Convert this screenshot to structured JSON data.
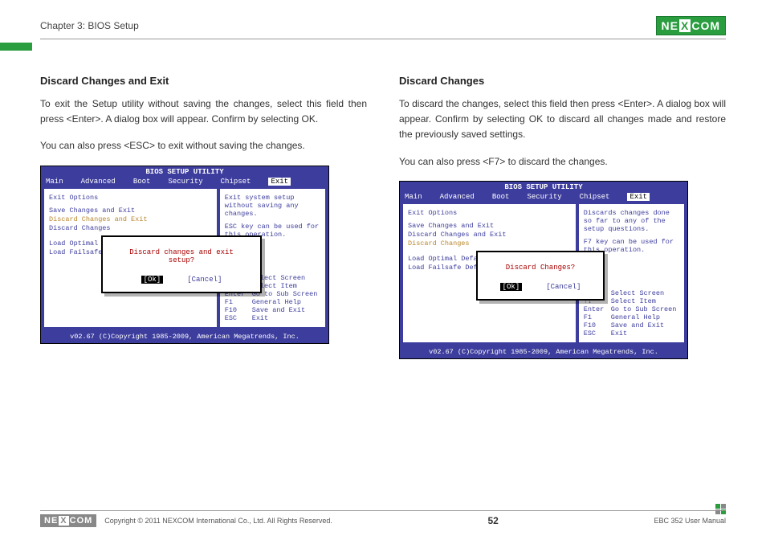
{
  "header": {
    "chapter": "Chapter 3: BIOS Setup",
    "brand": "NEXCOM"
  },
  "left": {
    "title": "Discard Changes and Exit",
    "p1": "To exit the Setup utility without saving the changes, select this field then press <Enter>. A dialog box will appear. Confirm by selecting OK.",
    "p2": "You can also press <ESC> to exit without saving the changes.",
    "bios": {
      "title": "BIOS SETUP UTILITY",
      "tabs": [
        "Main",
        "Advanced",
        "Boot",
        "Security",
        "Chipset",
        "Exit"
      ],
      "heading": "Exit Options",
      "items": [
        "Save Changes and Exit",
        "Discard Changes and Exit",
        "Discard Changes",
        "",
        "Load Optimal Defaults",
        "Load Failsafe Defaults"
      ],
      "selected_index": 1,
      "help1": "Exit system setup without saving any changes.",
      "help2": "ESC key can be used for this operation.",
      "nav": [
        {
          "k": "←→",
          "v": "Select Screen"
        },
        {
          "k": "↑↓",
          "v": "Select Item"
        },
        {
          "k": "Enter",
          "v": "Go to Sub Screen"
        },
        {
          "k": "F1",
          "v": "General Help"
        },
        {
          "k": "F10",
          "v": "Save and Exit"
        },
        {
          "k": "ESC",
          "v": "Exit"
        }
      ],
      "dialog": {
        "msg": "Discard changes and exit setup?",
        "ok": "[Ok]",
        "cancel": "[Cancel]"
      },
      "footer": "v02.67 (C)Copyright 1985-2009, American Megatrends, Inc."
    }
  },
  "right": {
    "title": "Discard Changes",
    "p1": "To discard the changes, select this field then press <Enter>. A dialog box will appear. Confirm by selecting OK to discard all changes made and restore the previously saved settings.",
    "p2": "You can also press <F7> to discard the changes.",
    "bios": {
      "title": "BIOS SETUP UTILITY",
      "tabs": [
        "Main",
        "Advanced",
        "Boot",
        "Security",
        "Chipset",
        "Exit"
      ],
      "heading": "Exit Options",
      "items": [
        "Save Changes and Exit",
        "Discard Changes and Exit",
        "Discard Changes",
        "",
        "Load Optimal Defaults",
        "Load Failsafe Defaults"
      ],
      "selected_index": 2,
      "help1": "Discards changes done so far to any of the setup questions.",
      "help2": "F7 key can be used for this operation.",
      "nav": [
        {
          "k": "←→",
          "v": "Select Screen"
        },
        {
          "k": "↑↓",
          "v": "Select Item"
        },
        {
          "k": "Enter",
          "v": "Go to Sub Screen"
        },
        {
          "k": "F1",
          "v": "General Help"
        },
        {
          "k": "F10",
          "v": "Save and Exit"
        },
        {
          "k": "ESC",
          "v": "Exit"
        }
      ],
      "dialog": {
        "msg": "Discard Changes?",
        "ok": "[Ok]",
        "cancel": "[Cancel]"
      },
      "footer": "v02.67 (C)Copyright 1985-2009, American Megatrends, Inc."
    }
  },
  "footer": {
    "brand": "NEXCOM",
    "copyright": "Copyright © 2011 NEXCOM International Co., Ltd. All Rights Reserved.",
    "page": "52",
    "manual": "EBC 352 User Manual"
  }
}
